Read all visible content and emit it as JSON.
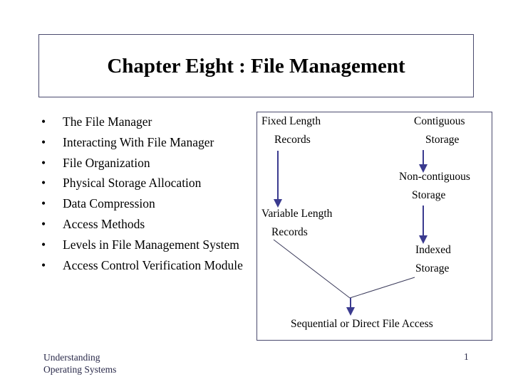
{
  "slide": {
    "title": "Chapter Eight : File Management",
    "bullet_glyph": "•",
    "bullets": [
      {
        "text": "The File Manager"
      },
      {
        "text": "Interacting With File Manager"
      },
      {
        "text": "File Organization"
      },
      {
        "text": "Physical Storage Allocation"
      },
      {
        "text": "Data Compression"
      },
      {
        "text": "Access Methods"
      },
      {
        "text": "Levels in File Management System"
      },
      {
        "text": "Access Control Verification Module"
      }
    ]
  },
  "diagram": {
    "nodes": {
      "fixed_line1": "Fixed Length",
      "fixed_line2": "Records",
      "variable_line1": "Variable Length",
      "variable_line2": "Records",
      "contiguous_line1": "Contiguous",
      "contiguous_line2": "Storage",
      "noncontiguous_line1": "Non-contiguous",
      "noncontiguous_line2": "Storage",
      "indexed_line1": "Indexed",
      "indexed_line2": "Storage",
      "access": "Sequential or Direct File Access"
    },
    "edges": [
      {
        "from": "Fixed Length Records",
        "to": "Variable Length Records",
        "style": "arrow"
      },
      {
        "from": "Contiguous Storage",
        "to": "Non-contiguous Storage",
        "style": "arrow"
      },
      {
        "from": "Non-contiguous Storage",
        "to": "Indexed Storage",
        "style": "arrow"
      },
      {
        "from": "Variable Length Records",
        "to": "Sequential or Direct File Access",
        "style": "merge-line"
      },
      {
        "from": "Indexed Storage",
        "to": "Sequential or Direct File Access",
        "style": "merge-line"
      }
    ],
    "colors": {
      "arrow": "#3b3b8f",
      "line": "#3a3a5a",
      "border": "#4a4a6e"
    }
  },
  "footer": {
    "left_line1": "Understanding",
    "left_line2": "Operating Systems",
    "page_number": "1"
  }
}
